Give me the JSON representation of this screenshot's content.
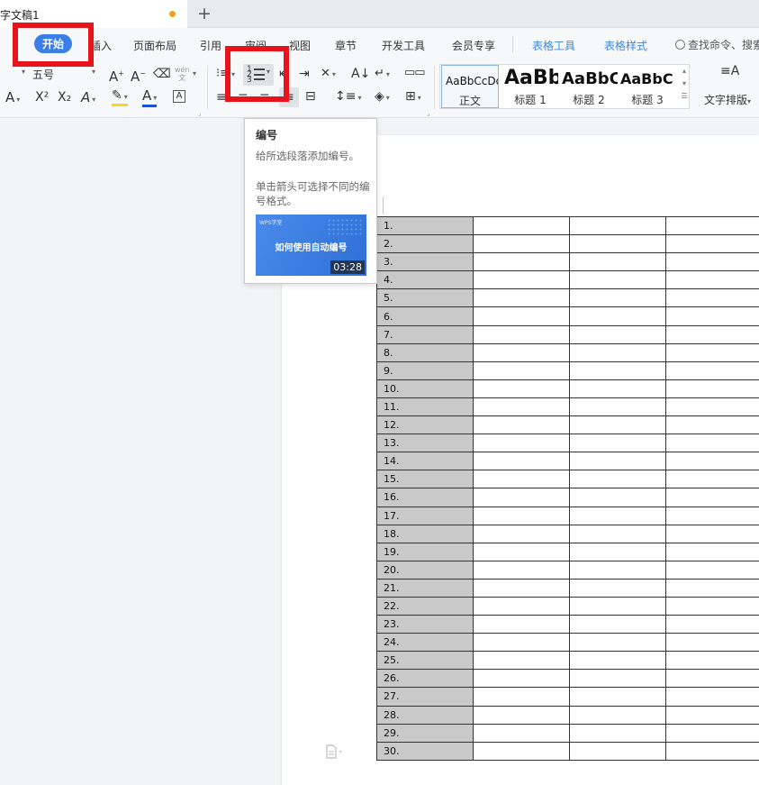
{
  "tabbar": {
    "doc_title": "字文稿1",
    "new_tab": "+"
  },
  "menu": {
    "items": [
      {
        "label": "开始",
        "active": true
      },
      {
        "label": "插入"
      },
      {
        "label": "页面布局"
      },
      {
        "label": "引用"
      },
      {
        "label": "审阅"
      },
      {
        "label": "视图"
      },
      {
        "label": "章节"
      },
      {
        "label": "开发工具"
      },
      {
        "label": "会员专享"
      },
      {
        "label": "表格工具"
      },
      {
        "label": "表格样式"
      }
    ],
    "search_label": "查找命令、搜索"
  },
  "toolbar": {
    "font_size": "五号",
    "wen_label": "wén\n文",
    "styles": [
      {
        "sample": "AaBbCcDd",
        "name": "正文"
      },
      {
        "sample": "AaBb",
        "name": "标题 1"
      },
      {
        "sample": "AaBbC",
        "name": "标题 2"
      },
      {
        "sample": "AaBbC",
        "name": "标题 3"
      }
    ],
    "text_layout_label": "文字排版"
  },
  "tooltip": {
    "title": "编号",
    "description": "给所选段落添加编号。",
    "hint": "单击箭头可选择不同的编号格式。",
    "video_logo": "WPS学堂",
    "video_title": "如何使用自动编号",
    "video_duration": "03:28"
  },
  "table": {
    "rows": [
      "1.",
      "2.",
      "3.",
      "4.",
      "5.",
      "6.",
      "7.",
      "8.",
      "9.",
      "10.",
      "11.",
      "12.",
      "13.",
      "14.",
      "15.",
      "16.",
      "17.",
      "18.",
      "19.",
      "20.",
      "21.",
      "22.",
      "23.",
      "24.",
      "25.",
      "26.",
      "27.",
      "28.",
      "29.",
      "30."
    ]
  },
  "colors": {
    "accent": "#3b7fe6",
    "highlight": "#e8141b",
    "table_shade": "#c9c9c9"
  }
}
